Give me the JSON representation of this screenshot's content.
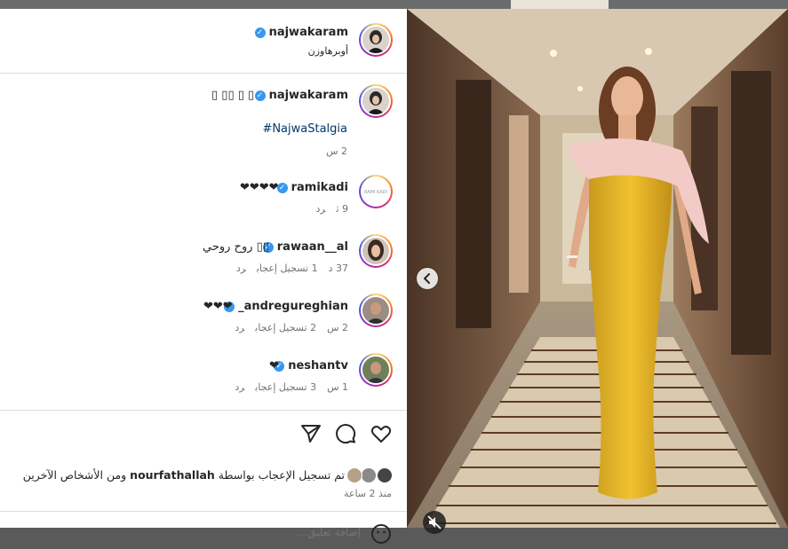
{
  "header": {
    "username": "najwakaram",
    "location": "أوبرهاوزن"
  },
  "caption": {
    "username": "najwakaram",
    "text": "▯ ▯▯ ▯ ▯",
    "hashtag": "#NajwaStalgia",
    "time": "2 س"
  },
  "comments": [
    {
      "username": "ramikadi",
      "text": "❤❤❤❤",
      "time": "9 ث",
      "likes": "",
      "reply": "رد"
    },
    {
      "username": "rawaan__al",
      "text": "روح روحي ▯▯",
      "time": "37 د",
      "likes": "1 تسجيل إعجاب",
      "reply": "رد"
    },
    {
      "username": "_andregureghian",
      "text": "❤❤❤",
      "time": "2 س",
      "likes": "2 تسجيل إعجاب",
      "reply": "رد"
    },
    {
      "username": "neshantv",
      "text": "❤",
      "time": "1 س",
      "likes": "3 تسجيل إعجاب",
      "reply": "رد"
    }
  ],
  "actions": {
    "liked_by_prefix": "تم تسجيل الإعجاب بواسطة ",
    "liked_by_user": "nourfathallah",
    "liked_by_suffix": " ومن الأشخاص الآخرين",
    "time_ago": "منذ 2 ساعة"
  },
  "add_comment": {
    "placeholder": "إضافة تعليق..."
  },
  "icons": {
    "like": "heart-icon",
    "comment": "comment-icon",
    "share": "share-icon",
    "emoji": "emoji-icon",
    "mute": "muted-speaker-icon",
    "prev": "chevron-left-icon",
    "verified": "verified-badge-icon"
  },
  "colors": {
    "link": "#00376b",
    "verified": "#3897f0",
    "dress": "#e8b62a"
  }
}
